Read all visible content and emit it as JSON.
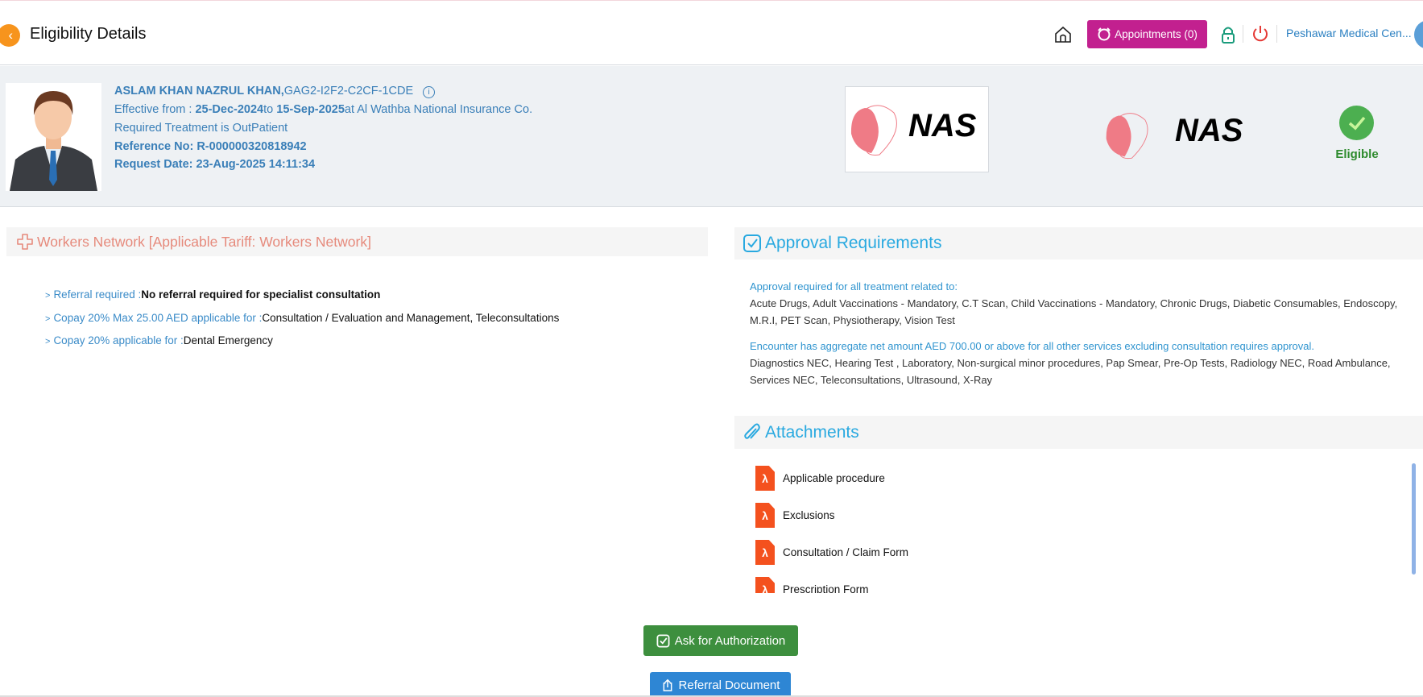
{
  "header": {
    "title": "Eligibility Details",
    "appointments_label": "Appointments (0)",
    "center_name": "Peshawar Medical Cen..."
  },
  "patient": {
    "name": "ASLAM KHAN NAZRUL KHAN,",
    "member_id": "GAG2-I2F2-C2CF-1CDE",
    "effective_prefix": "Effective from : ",
    "effective_from": "25-Dec-2024",
    "to_label": "to ",
    "effective_to": "15-Sep-2025",
    "insurer": "at Al Wathba National Insurance Co.",
    "treatment": "Required Treatment is OutPatient",
    "reference": "Reference No: R-000000320818942",
    "request_date": "Request Date: 23-Aug-2025 14:11:34"
  },
  "logos": {
    "logo1_text": "NAS",
    "logo2_text": "NAS"
  },
  "status": {
    "label": "Eligible",
    "color": "#4caf50"
  },
  "network": {
    "title": "Workers Network [Applicable Tariff: Workers Network]",
    "items": [
      {
        "key": "Referral required :",
        "value": "No referral required for specialist consultation"
      },
      {
        "key": "Copay 20% Max 25.00 AED applicable for :",
        "value": "Consultation / Evaluation and Management, Teleconsultations"
      },
      {
        "key": "Copay 20% applicable for :",
        "value": "Dental Emergency"
      }
    ]
  },
  "approval": {
    "title": "Approval Requirements",
    "blocks": [
      {
        "title": "Approval required for all treatment related to:",
        "value": "Acute Drugs, Adult Vaccinations - Mandatory, C.T Scan, Child Vaccinations - Mandatory, Chronic Drugs, Diabetic Consumables, Endoscopy, M.R.I, PET Scan, Physiotherapy, Vision Test"
      },
      {
        "title": "Encounter has aggregate net amount AED 700.00 or above for all other services excluding consultation requires approval.",
        "value": "Diagnostics NEC, Hearing Test , Laboratory, Non-surgical minor procedures, Pap Smear, Pre-Op Tests, Radiology NEC, Road Ambulance, Services NEC, Teleconsultations, Ultrasound, X-Ray"
      }
    ]
  },
  "attachments": {
    "title": "Attachments",
    "items": [
      "Applicable procedure",
      "Exclusions",
      "Consultation / Claim Form",
      "Prescription Form"
    ]
  },
  "actions": {
    "ask_label": "Ask for Authorization",
    "referral_label": "Referral Document"
  }
}
